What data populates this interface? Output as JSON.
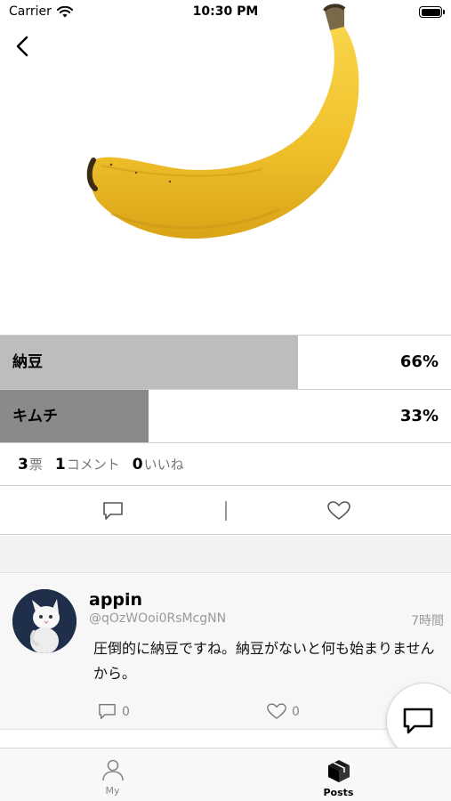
{
  "status_bar": {
    "carrier": "Carrier",
    "time": "10:30 PM"
  },
  "poll": {
    "options": [
      {
        "label": "納豆",
        "percent_text": "66%",
        "fraction": 0.66,
        "fill_color": "#bdbdbd"
      },
      {
        "label": "キムチ",
        "percent_text": "33%",
        "fraction": 0.33,
        "fill_color": "#8a8a8a"
      }
    ]
  },
  "stats": {
    "votes_count": "3",
    "votes_label": "票",
    "comments_count": "1",
    "comments_label": "コメント",
    "likes_count": "0",
    "likes_label": "いいね"
  },
  "comment": {
    "username": "appin",
    "handle": "@qOzWOoi0RsMcgNN",
    "time": "7時間",
    "text": "圧倒的に納豆ですね。納豆がないと何も始まりませんから。",
    "reply_count": "0",
    "like_count": "0"
  },
  "tabs": [
    {
      "label": "My",
      "icon": "person-icon",
      "active": false
    },
    {
      "label": "Posts",
      "icon": "box-icon",
      "active": true
    }
  ]
}
